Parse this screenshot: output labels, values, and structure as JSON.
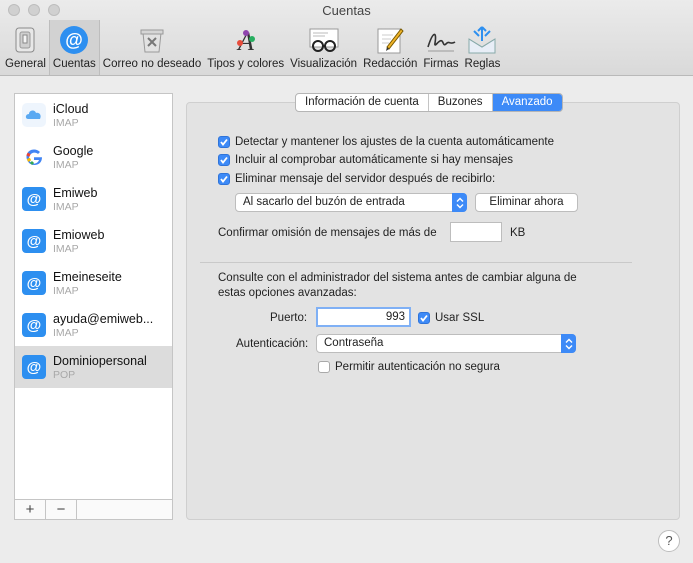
{
  "window": {
    "title": "Cuentas"
  },
  "toolbar": {
    "items": [
      {
        "label": "General",
        "icon": "general-icon"
      },
      {
        "label": "Cuentas",
        "icon": "at-icon"
      },
      {
        "label": "Correo no deseado",
        "icon": "junk-icon"
      },
      {
        "label": "Tipos y colores",
        "icon": "fonts-colors-icon"
      },
      {
        "label": "Visualización",
        "icon": "glasses-icon"
      },
      {
        "label": "Redacción",
        "icon": "compose-icon"
      },
      {
        "label": "Firmas",
        "icon": "signature-icon"
      },
      {
        "label": "Reglas",
        "icon": "rules-icon"
      }
    ],
    "active_index": 1
  },
  "sidebar": {
    "accounts": [
      {
        "name": "iCloud",
        "type": "IMAP",
        "icon": "icloud-icon"
      },
      {
        "name": "Google",
        "type": "IMAP",
        "icon": "google-icon"
      },
      {
        "name": "Emiweb",
        "type": "IMAP",
        "icon": "at-icon"
      },
      {
        "name": "Emioweb",
        "type": "IMAP",
        "icon": "at-icon"
      },
      {
        "name": "Emeineseite",
        "type": "IMAP",
        "icon": "at-icon"
      },
      {
        "name": "ayuda@emiweb...",
        "type": "IMAP",
        "icon": "at-icon"
      },
      {
        "name": "Dominiopersonal",
        "type": "POP",
        "icon": "at-icon"
      }
    ],
    "selected_index": 6,
    "add_label": "+",
    "remove_label": "−"
  },
  "tabs": {
    "items": [
      "Información de cuenta",
      "Buzones",
      "Avanzado"
    ],
    "active_index": 2
  },
  "advanced": {
    "detect_label": "Detectar y mantener los ajustes de la cuenta automáticamente",
    "detect_checked": true,
    "include_label": "Incluir al comprobar automáticamente si hay mensajes",
    "include_checked": true,
    "remove_label": "Eliminar mensaje del servidor después de recibirlo:",
    "remove_checked": true,
    "remove_when": "Al sacarlo del buzón de entrada",
    "remove_now_button": "Eliminar ahora",
    "size_label": "Confirmar omisión de mensajes de más de",
    "size_value": "",
    "size_unit": "KB",
    "notice_line1": "Consulte con el administrador del sistema antes de cambiar alguna de",
    "notice_line2": "estas opciones avanzadas:",
    "port_label": "Puerto:",
    "port_value": "993",
    "ssl_label": "Usar SSL",
    "ssl_checked": true,
    "auth_label": "Autenticación:",
    "auth_value": "Contraseña",
    "insecure_label": "Permitir autenticación no segura",
    "insecure_checked": false
  },
  "help": {
    "label": "?"
  },
  "colors": {
    "accent": "#3d8af7"
  }
}
